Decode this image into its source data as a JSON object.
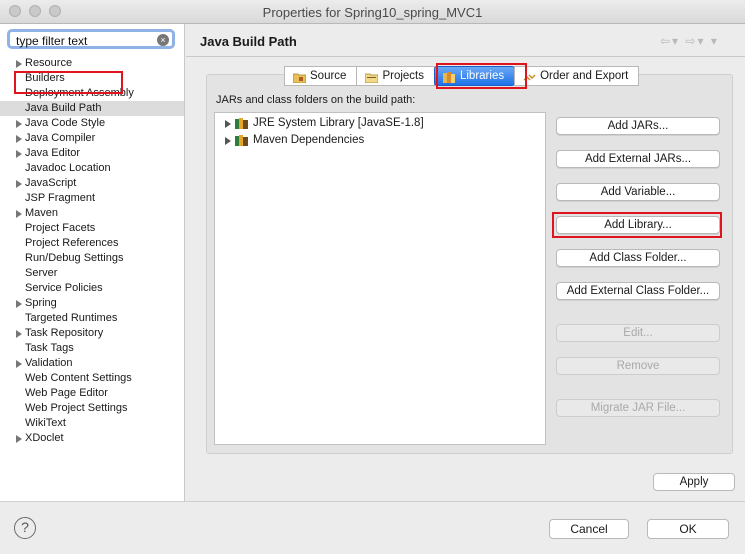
{
  "window": {
    "title": "Properties for Spring10_spring_MVC1"
  },
  "filter": {
    "value": "type filter text"
  },
  "tree": {
    "items": [
      {
        "label": "Resource",
        "expandable": true
      },
      {
        "label": "Builders",
        "expandable": false
      },
      {
        "label": "Deployment Assembly",
        "expandable": false
      },
      {
        "label": "Java Build Path",
        "expandable": false,
        "selected": true
      },
      {
        "label": "Java Code Style",
        "expandable": true
      },
      {
        "label": "Java Compiler",
        "expandable": true
      },
      {
        "label": "Java Editor",
        "expandable": true
      },
      {
        "label": "Javadoc Location",
        "expandable": false
      },
      {
        "label": "JavaScript",
        "expandable": true
      },
      {
        "label": "JSP Fragment",
        "expandable": false
      },
      {
        "label": "Maven",
        "expandable": true
      },
      {
        "label": "Project Facets",
        "expandable": false
      },
      {
        "label": "Project References",
        "expandable": false
      },
      {
        "label": "Run/Debug Settings",
        "expandable": false
      },
      {
        "label": "Server",
        "expandable": false
      },
      {
        "label": "Service Policies",
        "expandable": false
      },
      {
        "label": "Spring",
        "expandable": true
      },
      {
        "label": "Targeted Runtimes",
        "expandable": false
      },
      {
        "label": "Task Repository",
        "expandable": true
      },
      {
        "label": "Task Tags",
        "expandable": false
      },
      {
        "label": "Validation",
        "expandable": true
      },
      {
        "label": "Web Content Settings",
        "expandable": false
      },
      {
        "label": "Web Page Editor",
        "expandable": false
      },
      {
        "label": "Web Project Settings",
        "expandable": false
      },
      {
        "label": "WikiText",
        "expandable": false
      },
      {
        "label": "XDoclet",
        "expandable": true
      }
    ]
  },
  "page": {
    "title": "Java Build Path"
  },
  "tabs": [
    {
      "label": "Source",
      "icon": "source-folder-icon",
      "active": false
    },
    {
      "label": "Projects",
      "icon": "projects-icon",
      "active": false
    },
    {
      "label": "Libraries",
      "icon": "libraries-icon",
      "active": true
    },
    {
      "label": "Order and Export",
      "icon": "order-export-icon",
      "active": false
    }
  ],
  "libraries": {
    "label": "JARs and class folders on the build path:",
    "entries": [
      {
        "label": "JRE System Library [JavaSE-1.8]",
        "icon": "library-icon"
      },
      {
        "label": "Maven Dependencies",
        "icon": "library-icon"
      }
    ]
  },
  "buttons": {
    "add_jars": "Add JARs...",
    "add_external_jars": "Add External JARs...",
    "add_variable": "Add Variable...",
    "add_library": "Add Library...",
    "add_class_folder": "Add Class Folder...",
    "add_external_class_folder": "Add External Class Folder...",
    "edit": "Edit...",
    "remove": "Remove",
    "migrate_jar": "Migrate JAR File..."
  },
  "footer": {
    "apply": "Apply",
    "cancel": "Cancel",
    "ok": "OK",
    "help": "?"
  },
  "colors": {
    "highlight_red": "#e0141e",
    "active_tab": "#1f72e8"
  }
}
